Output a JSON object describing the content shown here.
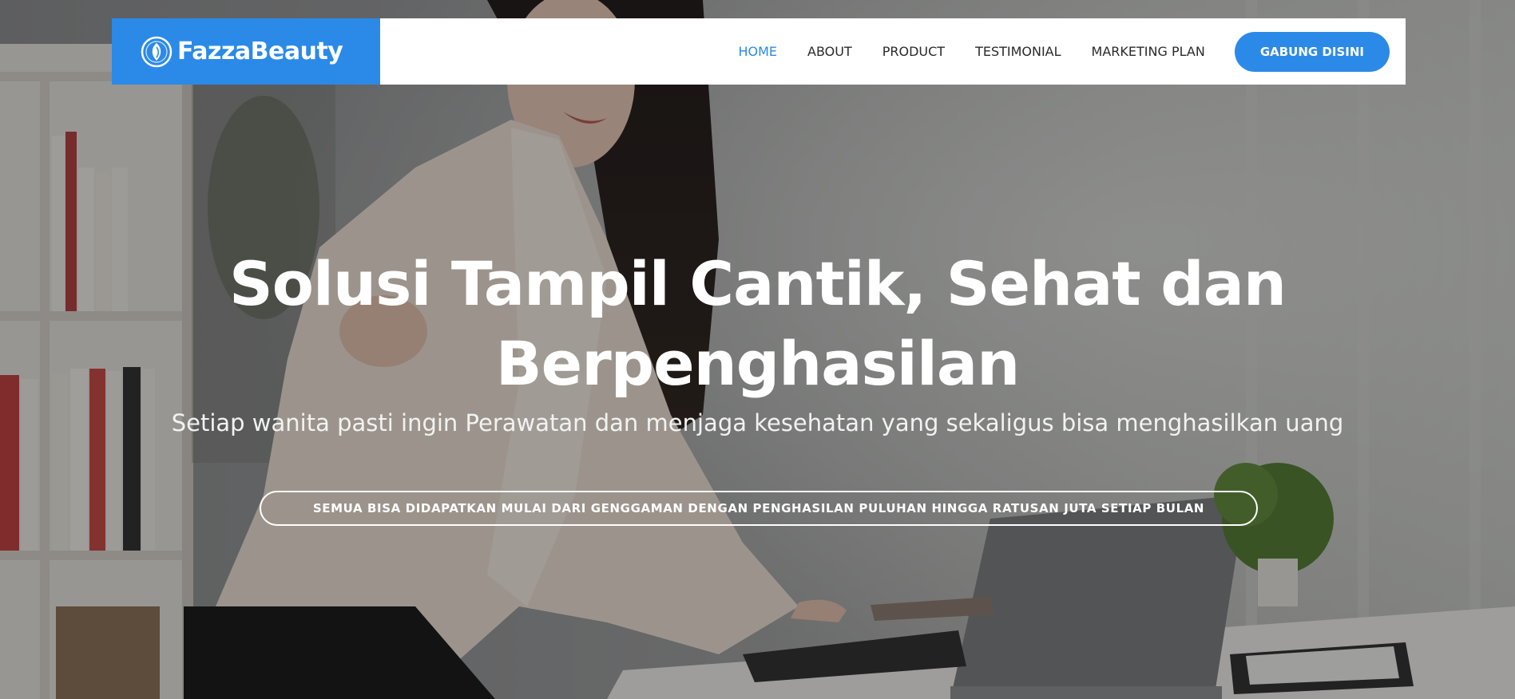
{
  "brand": {
    "name": "FazzaBeauty",
    "icon": "leaf-drop-logo-icon",
    "color": "#2b8ae8"
  },
  "nav": {
    "items": [
      {
        "label": "HOME",
        "active": true
      },
      {
        "label": "ABOUT",
        "active": false
      },
      {
        "label": "PRODUCT",
        "active": false
      },
      {
        "label": "TESTIMONIAL",
        "active": false
      },
      {
        "label": "MARKETING PLAN",
        "active": false
      }
    ],
    "cta_label": "GABUNG DISINI"
  },
  "hero": {
    "headline_line1": "Solusi Tampil Cantik, Sehat dan",
    "headline_line2": "Berpenghasilan",
    "subheadline": "Setiap wanita pasti ingin Perawatan dan menjaga kesehatan yang sekaligus bisa menghasilkan uang",
    "pill_text": "SEMUA BISA DIDAPATKAN MULAI DARI GENGGAMAN DENGAN PENGHASILAN PULUHAN HINGGA RATUSAN JUTA SETIAP BULAN"
  },
  "colors": {
    "accent": "#2b8ae8",
    "nav_text": "#2a2a2a",
    "hero_text": "#ffffff"
  }
}
